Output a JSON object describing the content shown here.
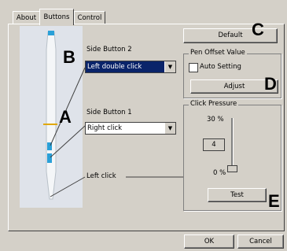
{
  "tabs": [
    {
      "label": "About"
    },
    {
      "label": "Buttons"
    },
    {
      "label": "Control"
    }
  ],
  "active_tab": "Buttons",
  "side_button_2": {
    "label": "Side Button 2",
    "value": "Left double click"
  },
  "side_button_1": {
    "label": "Side Button 1",
    "value": "Right click"
  },
  "tip": {
    "label": "Left click"
  },
  "default_button": "Default",
  "pen_offset": {
    "title": "Pen Offset Value",
    "auto_setting": "Auto Setting",
    "adjust_button": "Adjust"
  },
  "click_pressure": {
    "title": "Click Pressure",
    "max_label": "30 %",
    "value": "4",
    "min_label": "0 %",
    "test_button": "Test"
  },
  "annotations": {
    "A": "A",
    "B": "B",
    "C": "C",
    "D": "D",
    "E": "E"
  },
  "footer": {
    "ok": "OK",
    "cancel": "Cancel"
  }
}
